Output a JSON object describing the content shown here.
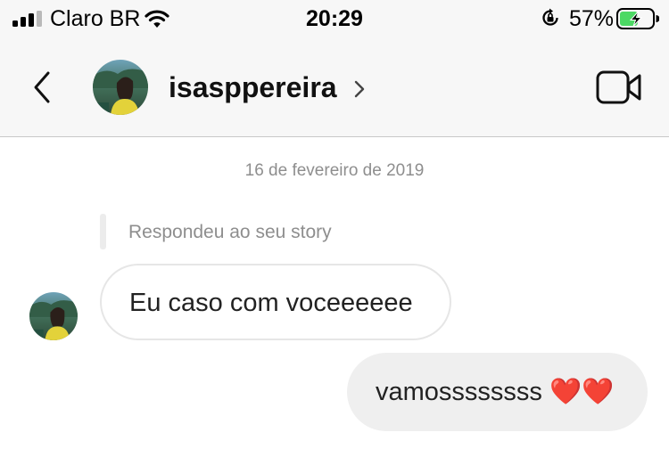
{
  "status_bar": {
    "carrier": "Claro BR",
    "time": "20:29",
    "battery_percent": "57%",
    "battery_level": 0.57,
    "icons": [
      "signal-icon",
      "wifi-icon",
      "orientation-lock-icon",
      "battery-charging-icon"
    ]
  },
  "header": {
    "username": "isasppereira",
    "icons": [
      "back-chevron-icon",
      "profile-avatar",
      "chevron-right-icon",
      "video-call-icon"
    ]
  },
  "chat": {
    "date": "16 de fevereiro de 2019",
    "story_reply_label": "Respondeu ao seu story",
    "messages": [
      {
        "from": "them",
        "text": "Eu caso com voceeeeee"
      },
      {
        "from": "me",
        "text": "vamossssssss ❤️❤️"
      }
    ]
  },
  "colors": {
    "bar_background": "#f7f7f7",
    "outgoing_bubble": "#efefef",
    "incoming_bubble_border": "#e6e6e6",
    "secondary_text": "#8e8e8e",
    "battery_charging": "#4cd964"
  }
}
